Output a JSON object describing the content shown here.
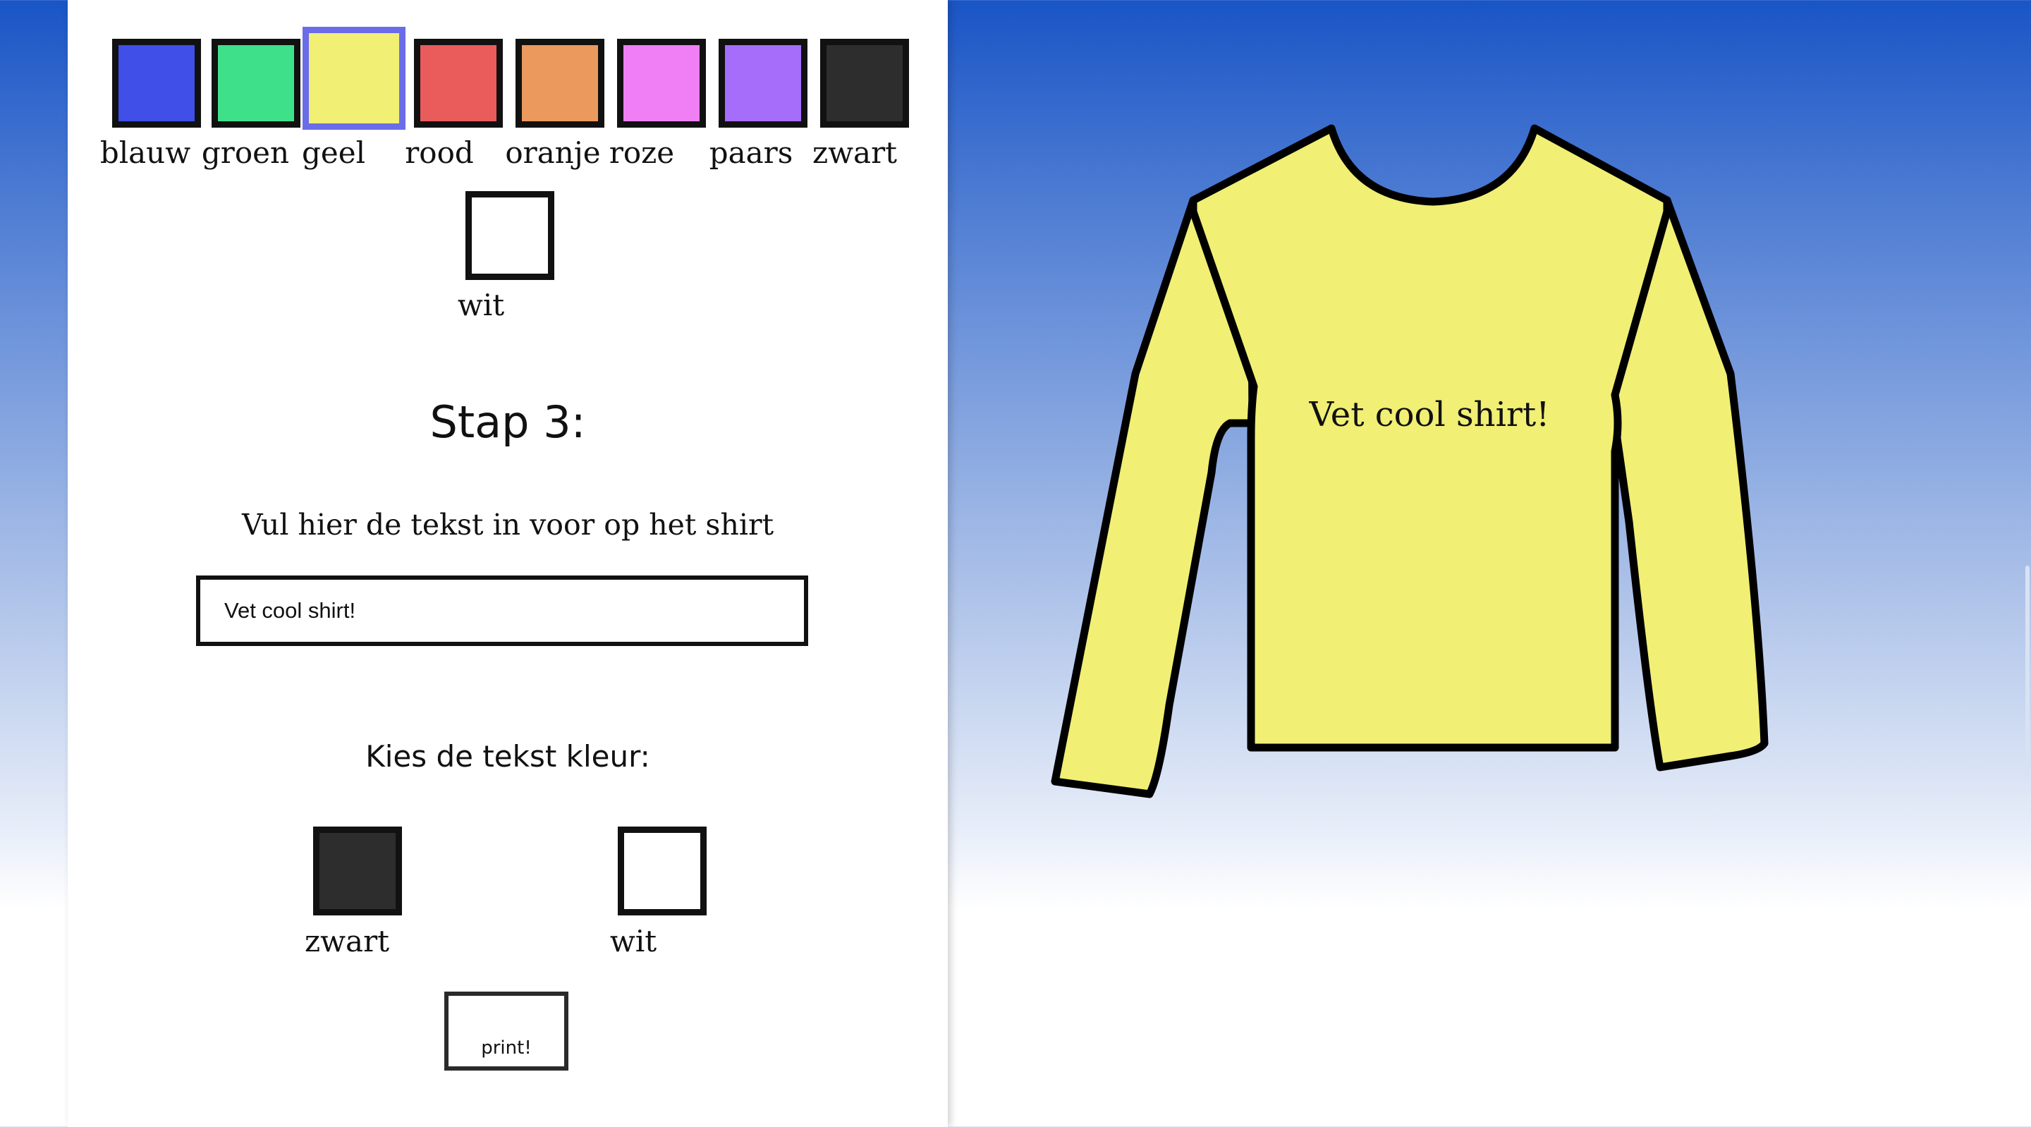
{
  "shirt_colors": [
    {
      "label": "blauw",
      "color": "#3f4fe8",
      "selected": false
    },
    {
      "label": "groen",
      "color": "#3fe08a",
      "selected": false
    },
    {
      "label": "geel",
      "color": "#f1ef74",
      "selected": true
    },
    {
      "label": "rood",
      "color": "#ea5b5c",
      "selected": false
    },
    {
      "label": "oranje",
      "color": "#ec995d",
      "selected": false
    },
    {
      "label": "roze",
      "color": "#f07ff5",
      "selected": false
    },
    {
      "label": "paars",
      "color": "#a56dfa",
      "selected": false
    },
    {
      "label": "zwart",
      "color": "#2d2d2d",
      "selected": false
    },
    {
      "label": "wit",
      "color": "#ffffff",
      "selected": false
    }
  ],
  "step": {
    "title": "Stap 3:",
    "instruction": "Vul hier de tekst in voor op het shirt"
  },
  "text_input": {
    "value": "Vet cool shirt!"
  },
  "text_color": {
    "heading": "Kies de tekst kleur:",
    "options": [
      {
        "label": "zwart",
        "color": "#2d2d2d"
      },
      {
        "label": "wit",
        "color": "#ffffff"
      }
    ]
  },
  "print_button": {
    "label": "print!"
  },
  "preview": {
    "shirt_color": "#f1ef74",
    "shirt_text": "Vet cool shirt!",
    "text_color": "#111111"
  }
}
